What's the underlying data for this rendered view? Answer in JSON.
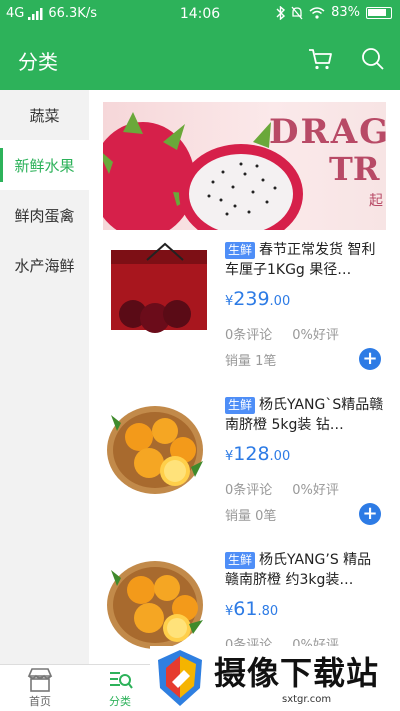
{
  "status": {
    "network": "4G",
    "speed": "66.3K/s",
    "time": "14:06",
    "battery": "83%"
  },
  "header": {
    "title": "分类",
    "icons": [
      "cart-icon",
      "search-icon"
    ]
  },
  "sidebar": {
    "items": [
      {
        "label": "蔬菜"
      },
      {
        "label": "新鲜水果",
        "active": true
      },
      {
        "label": "鲜肉蛋禽"
      },
      {
        "label": "水产海鲜"
      }
    ]
  },
  "banner": {
    "text_line1": "DRAGO",
    "text_line2": "TR",
    "text_cn": "起"
  },
  "products": [
    {
      "tag": "生鲜",
      "title": "春节正常发货 智利车厘子1KGg 果径…",
      "price_symbol": "¥",
      "price_int": "239",
      "price_dec": ".00",
      "reviews": "0条评论",
      "good_rate": "0%好评",
      "sales": "销量 1笔"
    },
    {
      "tag": "生鲜",
      "title": "杨氏YANG`S精品赣南脐橙 5kg装 钻…",
      "price_symbol": "¥",
      "price_int": "128",
      "price_dec": ".00",
      "reviews": "0条评论",
      "good_rate": "0%好评",
      "sales": "销量 0笔"
    },
    {
      "tag": "生鲜",
      "title": "杨氏YANG’S 精品赣南脐橙 约3kg装…",
      "price_symbol": "¥",
      "price_int": "61",
      "price_dec": ".80",
      "reviews": "0条评论",
      "good_rate": "0%好评",
      "sales": ""
    }
  ],
  "tabbar": {
    "home": "首页",
    "category": "分类"
  },
  "watermark": {
    "text": "摄像下载站",
    "url": "sxtgr.com"
  },
  "colors": {
    "brand_green": "#2db25a",
    "price_blue": "#2d7be5",
    "tag_blue": "#4e8ef7"
  }
}
